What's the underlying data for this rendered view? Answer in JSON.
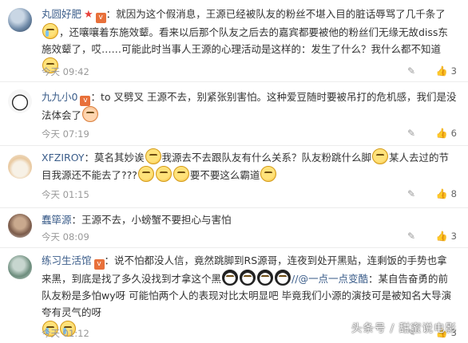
{
  "comments": [
    {
      "username": "丸圆好肥",
      "body_1": "就因为这个假消息，王源已经被队友的粉丝不堪入目的脏话辱骂了几千条了",
      "body_2": "，还嚷嚷着东施效颦。看来以后那个队友之后去的嘉宾都要被他的粉丝们无缘无故diss东施效颦了，哎……可能此时当事人王源的心理活动是这样的：发生了什么？我什么都不知道",
      "time": "今天 09:42",
      "likes": "3"
    },
    {
      "username": "九九小0",
      "body_1": "to 叉劈叉  王源不去，别紧张别害怕。这种爱豆随时要被吊打的危机感，我们是没法体会了",
      "time": "今天 07:19",
      "likes": "6"
    },
    {
      "username": "XFZIROY",
      "body_1": "莫名其妙诶",
      "body_2": "我源去不去跟队友有什么关系？队友粉跳什么脚",
      "body_3": "某人去过的节目我源还不能去了???",
      "body_4": "要不要这么霸道",
      "time": "今天 01:15",
      "likes": "8"
    },
    {
      "username": "蠢筚源",
      "body_1": "王源不去，小螃蟹不要担心与害怕",
      "time": "今天 08:09",
      "likes": "3"
    },
    {
      "username": "练习生活馆",
      "body_1": "说不怕都没人信，竟然跳脚到RS源哥，连夜到处开黑贴，连剩饭的手势也拿来黑，到底是找了多久没找到才拿这个黑",
      "mention": "//@一点一点变酷",
      "body_2": "：某自告奋勇的前队友粉是多怕wy呀 可能怕两个人的表现对比太明显吧 毕竟我们小源的演技可是被知名大导演夸有灵气的呀",
      "time": "今天 01:12",
      "likes": "3"
    }
  ],
  "icons": {
    "reply": "reply-icon",
    "like": "thumbs-up-icon",
    "badge_vip": "vip-badge-icon",
    "badge_star": "star-badge-icon"
  },
  "watermark": "头条号 / 甜蜜说电影"
}
